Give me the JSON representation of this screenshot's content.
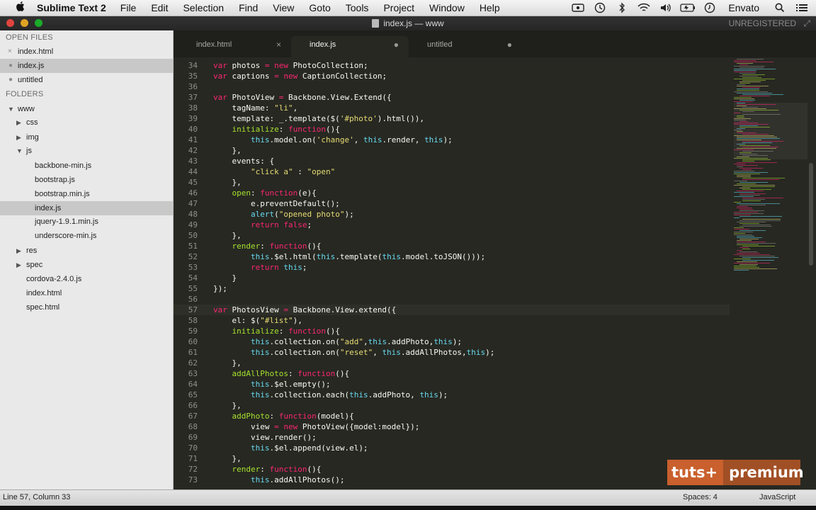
{
  "menubar": {
    "app": "Sublime Text 2",
    "items": [
      "File",
      "Edit",
      "Selection",
      "Find",
      "View",
      "Goto",
      "Tools",
      "Project",
      "Window",
      "Help"
    ],
    "user": "Envato"
  },
  "window": {
    "title": "index.js — www",
    "license": "UNREGISTERED"
  },
  "sidebar": {
    "open_files_label": "OPEN FILES",
    "open_files": [
      "index.html",
      "index.js",
      "untitled"
    ],
    "folders_label": "FOLDERS",
    "tree": [
      "www",
      "css",
      "img",
      "js",
      "backbone-min.js",
      "bootstrap.js",
      "bootstrap.min.js",
      "index.js",
      "jquery-1.9.1.min.js",
      "underscore-min.js",
      "res",
      "spec",
      "cordova-2.4.0.js",
      "index.html",
      "spec.html"
    ]
  },
  "tabs": [
    "index.html",
    "index.js",
    "untitled"
  ],
  "editor": {
    "line_numbers": [
      "34",
      "35",
      "36",
      "37",
      "38",
      "39",
      "40",
      "41",
      "42",
      "43",
      "44",
      "45",
      "46",
      "47",
      "48",
      "49",
      "50",
      "51",
      "52",
      "53",
      "54",
      "55",
      "56",
      "57",
      "58",
      "59",
      "60",
      "61",
      "62",
      "63",
      "64",
      "65",
      "66",
      "67",
      "68",
      "69",
      "70",
      "71",
      "72",
      "73"
    ],
    "lines": [
      "var photos = new PhotoCollection;",
      "var captions = new CaptionCollection;",
      "",
      "var PhotoView = Backbone.View.Extend({",
      "    tagName: \"li\",",
      "    template: _.template($('#photo').html()),",
      "    initialize: function(){",
      "        this.model.on('change', this.render, this);",
      "    },",
      "    events: {",
      "        \"click a\" : \"open\"",
      "    },",
      "    open: function(e){",
      "        e.preventDefault();",
      "        alert(\"opened photo\");",
      "        return false;",
      "    },",
      "    render: function(){",
      "        this.$el.html(this.template(this.model.toJSON()));",
      "        return this;",
      "    }",
      "});",
      "",
      "var PhotosView = Backbone.View.extend({",
      "    el: $(\"#list\"),",
      "    initialize: function(){",
      "        this.collection.on(\"add\",this.addPhoto,this);",
      "        this.collection.on(\"reset\", this.addAllPhotos,this);",
      "    },",
      "    addAllPhotos: function(){",
      "        this.$el.empty();",
      "        this.collection.each(this.addPhoto, this);",
      "    },",
      "    addPhoto: function(model){",
      "        view = new PhotoView({model:model});",
      "        view.render();",
      "        this.$el.append(view.el);",
      "    },",
      "    render: function(){",
      "        this.addAllPhotos();"
    ]
  },
  "status": {
    "position": "Line 57, Column 33",
    "indent": "Spaces: 4",
    "syntax": "JavaScript"
  },
  "watermark": {
    "left": "tuts+",
    "right": "premium"
  },
  "colors": {
    "keyword": "#f92672",
    "function": "#a6e22e",
    "string": "#e6db74",
    "builtin": "#66d9ef",
    "background": "#272822"
  }
}
